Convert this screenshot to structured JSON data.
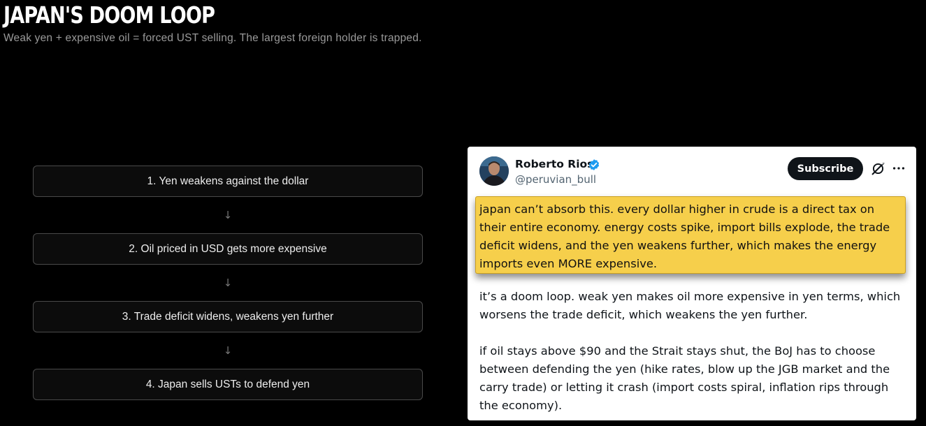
{
  "header": {
    "title": "JAPAN'S DOOM LOOP",
    "subtitle": "Weak yen + expensive oil = forced UST selling. The largest foreign holder is trapped."
  },
  "flow": {
    "steps": [
      "1. Yen weakens against the dollar",
      "2. Oil priced in USD gets more expensive",
      "3. Trade deficit widens, weakens yen further",
      "4. Japan sells USTs to defend yen"
    ],
    "arrow": "↓"
  },
  "tweet": {
    "author_name": "Roberto Rios",
    "handle": "@peruvian_bull",
    "subscribe_label": "Subscribe",
    "highlighted_text": "japan can’t absorb this. every dollar higher in crude is a direct tax on their entire economy. energy costs spike, import bills explode, the trade deficit widens, and the yen weakens further, which makes the energy imports even MORE expensive.",
    "paragraph_1": "it’s a doom loop. weak yen makes oil more expensive in yen terms, which worsens the trade deficit, which weakens the yen further.",
    "paragraph_2": "if oil stays above $90 and the Strait stays shut, the BoJ has to choose between defending the yen (hike rates, blow up the JGB market and the carry trade) or letting it crash (import costs spiral, inflation rips through the economy).",
    "icons": [
      "verified-badge-icon",
      "grok-icon",
      "more-options-icon"
    ]
  },
  "colors": {
    "background": "#000000",
    "highlight": "#f6cf4b",
    "verified": "#1d9bf0"
  }
}
